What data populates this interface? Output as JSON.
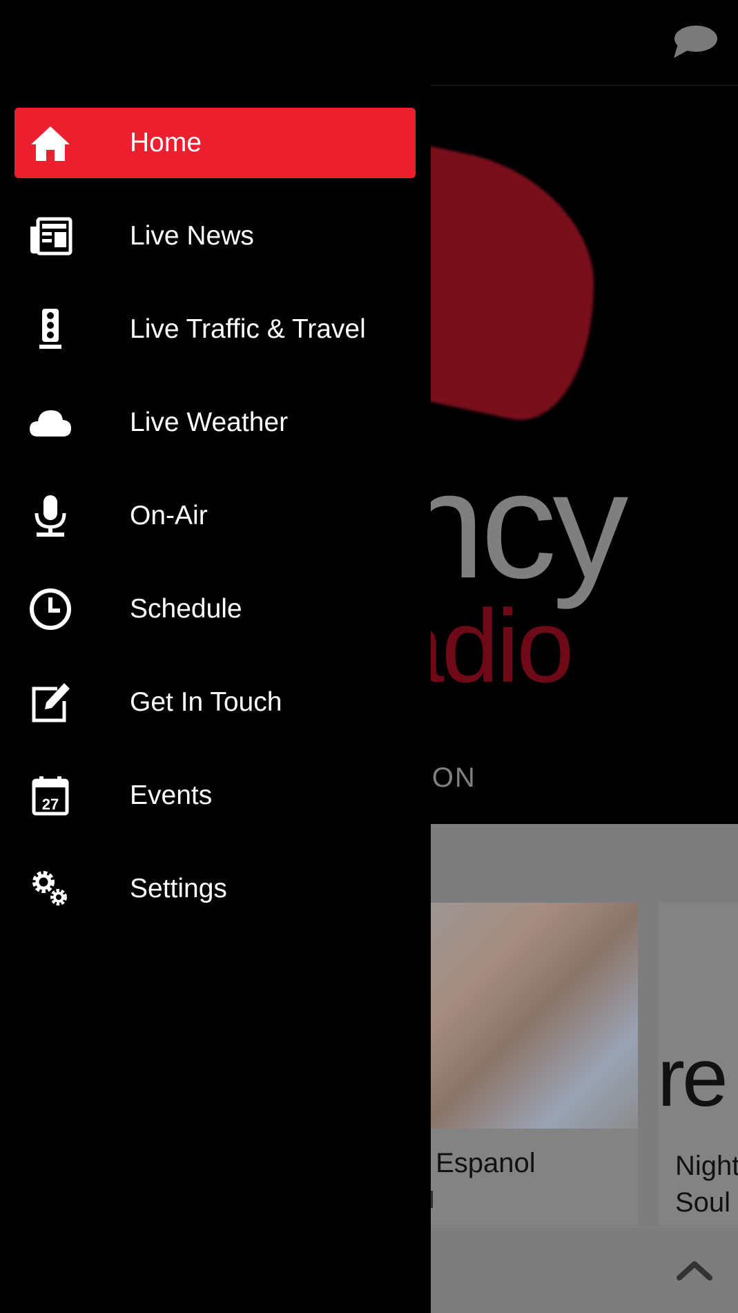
{
  "background": {
    "logo_partial_text_1": "ncy",
    "logo_partial_text_2": "adio",
    "location_partial": "TON",
    "cards": [
      {
        "title": "s Espanol",
        "subtitle": "M"
      },
      {
        "title": "Night\nSoul",
        "image_text": "re"
      }
    ]
  },
  "drawer": {
    "accent": "#ec1f2e",
    "items": [
      {
        "label": "Home",
        "icon": "home-icon",
        "active": true
      },
      {
        "label": "Live News",
        "icon": "newspaper-icon"
      },
      {
        "label": "Live Traffic & Travel",
        "icon": "traffic-light-icon"
      },
      {
        "label": "Live Weather",
        "icon": "cloud-icon"
      },
      {
        "label": "On-Air",
        "icon": "microphone-icon"
      },
      {
        "label": "Schedule",
        "icon": "clock-icon"
      },
      {
        "label": "Get In Touch",
        "icon": "edit-icon"
      },
      {
        "label": "Events",
        "icon": "calendar-icon",
        "icon_text": "27"
      },
      {
        "label": "Settings",
        "icon": "gears-icon"
      }
    ]
  }
}
